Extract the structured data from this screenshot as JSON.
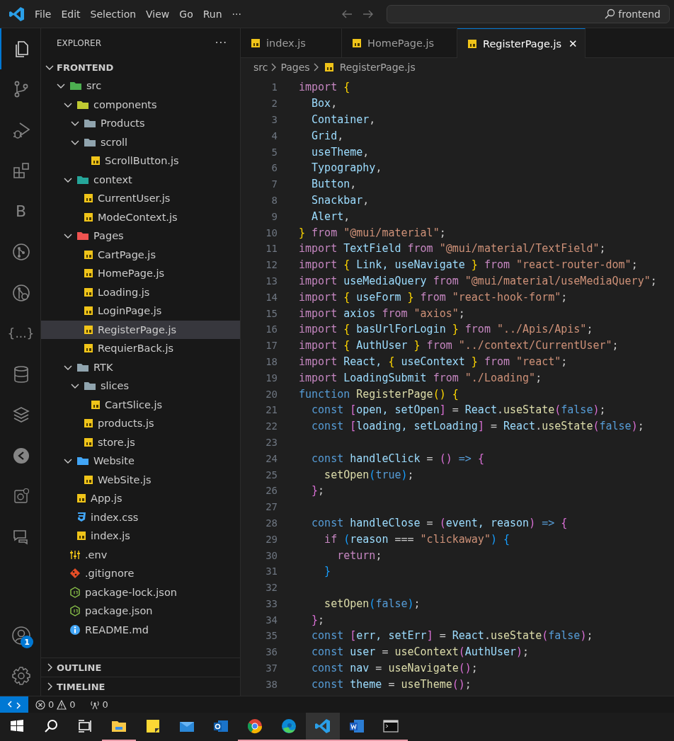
{
  "title_bar": {
    "menu": [
      "File",
      "Edit",
      "Selection",
      "View",
      "Go",
      "Run",
      "···"
    ],
    "command_center": {
      "value": "frontend"
    }
  },
  "activity_bar": {
    "items": [
      {
        "kind": "explorer",
        "selected": true
      },
      {
        "kind": "source-control",
        "selected": false
      },
      {
        "kind": "run-debug",
        "selected": false
      },
      {
        "kind": "extensions",
        "selected": false
      },
      {
        "kind": "letter",
        "text": "B",
        "selected": false
      },
      {
        "kind": "git-graph",
        "selected": false
      },
      {
        "kind": "git-search",
        "selected": false
      },
      {
        "kind": "letter",
        "text": "{...}",
        "selected": false
      },
      {
        "kind": "database",
        "selected": false
      },
      {
        "kind": "layers",
        "selected": false
      },
      {
        "kind": "remote",
        "selected": false
      },
      {
        "kind": "chip",
        "selected": false
      },
      {
        "kind": "chat",
        "selected": false
      }
    ],
    "bottom": [
      {
        "kind": "account",
        "badge": "1"
      },
      {
        "kind": "settings"
      }
    ]
  },
  "sidebar": {
    "title": "EXPLORER",
    "more": "···",
    "root": {
      "label": "FRONTEND",
      "expanded": true,
      "children": [
        {
          "label": "src",
          "kind": "folder",
          "color": "#4caf50",
          "expanded": true,
          "selected": false,
          "children": [
            {
              "label": "components",
              "kind": "folder",
              "color": "#c0ca33",
              "expanded": true,
              "selected": false,
              "children": [
                {
                  "label": "Products",
                  "kind": "folder",
                  "color": "#90a4ae",
                  "expanded": true,
                  "selected": false
                },
                {
                  "label": "scroll",
                  "kind": "folder",
                  "color": "#90a4ae",
                  "expanded": true,
                  "selected": false,
                  "children": [
                    {
                      "label": "ScrollButton.js",
                      "kind": "js",
                      "selected": false
                    }
                  ]
                }
              ]
            },
            {
              "label": "context",
              "kind": "folder",
              "color": "#26a69a",
              "expanded": true,
              "selected": false,
              "children": [
                {
                  "label": "CurrentUser.js",
                  "kind": "js",
                  "selected": false
                },
                {
                  "label": "ModeContext.js",
                  "kind": "js",
                  "selected": false
                }
              ]
            },
            {
              "label": "Pages",
              "kind": "folder",
              "color": "#ef5350",
              "expanded": true,
              "selected": false,
              "children": [
                {
                  "label": "CartPage.js",
                  "kind": "js",
                  "selected": false
                },
                {
                  "label": "HomePage.js",
                  "kind": "js",
                  "selected": false
                },
                {
                  "label": "Loading.js",
                  "kind": "js",
                  "selected": false
                },
                {
                  "label": "LoginPage.js",
                  "kind": "js",
                  "selected": false
                },
                {
                  "label": "RegisterPage.js",
                  "kind": "js",
                  "selected": true
                },
                {
                  "label": "RequierBack.js",
                  "kind": "js",
                  "selected": false
                }
              ]
            },
            {
              "label": "RTK",
              "kind": "folder",
              "color": "#90a4ae",
              "expanded": true,
              "selected": false,
              "children": [
                {
                  "label": "slices",
                  "kind": "folder",
                  "color": "#90a4ae",
                  "expanded": true,
                  "selected": false,
                  "children": [
                    {
                      "label": "CartSlice.js",
                      "kind": "js",
                      "selected": false
                    }
                  ]
                },
                {
                  "label": "products.js",
                  "kind": "js",
                  "selected": false
                },
                {
                  "label": "store.js",
                  "kind": "js",
                  "selected": false
                }
              ]
            },
            {
              "label": "Website",
              "kind": "folder",
              "color": "#42a5f5",
              "expanded": true,
              "selected": false,
              "children": [
                {
                  "label": "WebSite.js",
                  "kind": "js",
                  "selected": false
                }
              ]
            },
            {
              "label": "App.js",
              "kind": "js",
              "selected": false
            },
            {
              "label": "index.css",
              "kind": "css",
              "selected": false
            },
            {
              "label": "index.js",
              "kind": "js",
              "selected": false
            }
          ]
        },
        {
          "label": ".env",
          "kind": "env",
          "selected": false
        },
        {
          "label": ".gitignore",
          "kind": "git",
          "selected": false
        },
        {
          "label": "package-lock.json",
          "kind": "node",
          "selected": false
        },
        {
          "label": "package.json",
          "kind": "node",
          "selected": false
        },
        {
          "label": "README.md",
          "kind": "info",
          "selected": false
        }
      ]
    },
    "sections": [
      {
        "label": "OUTLINE",
        "expanded": false
      },
      {
        "label": "TIMELINE",
        "expanded": false
      }
    ]
  },
  "tabs": [
    {
      "label": "index.js",
      "selected": false
    },
    {
      "label": "HomePage.js",
      "selected": false
    },
    {
      "label": "RegisterPage.js",
      "selected": true,
      "close": "✕"
    }
  ],
  "breadcrumbs": [
    {
      "label": "src"
    },
    {
      "label": "Pages"
    },
    {
      "label": "RegisterPage.js",
      "kind": "js"
    }
  ],
  "code": [
    {
      "number": "1",
      "tokens": [
        {
          "kind": "keyword",
          "text": "import "
        },
        {
          "kind": "bracket1",
          "text": "{"
        }
      ]
    },
    {
      "number": "2",
      "tokens": [
        {
          "kind": "variable",
          "text": "  Box"
        },
        {
          "kind": "plain",
          "text": ","
        }
      ]
    },
    {
      "number": "3",
      "tokens": [
        {
          "kind": "variable",
          "text": "  Container"
        },
        {
          "kind": "plain",
          "text": ","
        }
      ]
    },
    {
      "number": "4",
      "tokens": [
        {
          "kind": "variable",
          "text": "  Grid"
        },
        {
          "kind": "plain",
          "text": ","
        }
      ]
    },
    {
      "number": "5",
      "tokens": [
        {
          "kind": "variable",
          "text": "  useTheme"
        },
        {
          "kind": "plain",
          "text": ","
        }
      ]
    },
    {
      "number": "6",
      "tokens": [
        {
          "kind": "variable",
          "text": "  Typography"
        },
        {
          "kind": "plain",
          "text": ","
        }
      ]
    },
    {
      "number": "7",
      "tokens": [
        {
          "kind": "variable",
          "text": "  Button"
        },
        {
          "kind": "plain",
          "text": ","
        }
      ]
    },
    {
      "number": "8",
      "tokens": [
        {
          "kind": "variable",
          "text": "  Snackbar"
        },
        {
          "kind": "plain",
          "text": ","
        }
      ]
    },
    {
      "number": "9",
      "tokens": [
        {
          "kind": "variable",
          "text": "  Alert"
        },
        {
          "kind": "plain",
          "text": ","
        }
      ]
    },
    {
      "number": "10",
      "tokens": [
        {
          "kind": "bracket1",
          "text": "}"
        },
        {
          "kind": "keyword",
          "text": " from "
        },
        {
          "kind": "string",
          "text": "\"@mui/material\""
        },
        {
          "kind": "plain",
          "text": ";"
        }
      ]
    },
    {
      "number": "11",
      "tokens": [
        {
          "kind": "keyword",
          "text": "import"
        },
        {
          "kind": "variable",
          "text": " TextField "
        },
        {
          "kind": "keyword",
          "text": "from"
        },
        {
          "kind": "string",
          "text": " \"@mui/material/TextField\""
        },
        {
          "kind": "plain",
          "text": ";"
        }
      ]
    },
    {
      "number": "12",
      "tokens": [
        {
          "kind": "keyword",
          "text": "import "
        },
        {
          "kind": "bracket1",
          "text": "{"
        },
        {
          "kind": "variable",
          "text": " Link, useNavigate "
        },
        {
          "kind": "bracket1",
          "text": "}"
        },
        {
          "kind": "keyword",
          "text": " from "
        },
        {
          "kind": "string",
          "text": "\"react-router-dom\""
        },
        {
          "kind": "plain",
          "text": ";"
        }
      ]
    },
    {
      "number": "13",
      "tokens": [
        {
          "kind": "keyword",
          "text": "import"
        },
        {
          "kind": "variable",
          "text": " useMediaQuery "
        },
        {
          "kind": "keyword",
          "text": "from"
        },
        {
          "kind": "string",
          "text": " \"@mui/material/useMediaQuery\""
        },
        {
          "kind": "plain",
          "text": ";"
        }
      ]
    },
    {
      "number": "14",
      "tokens": [
        {
          "kind": "keyword",
          "text": "import "
        },
        {
          "kind": "bracket1",
          "text": "{"
        },
        {
          "kind": "variable",
          "text": " useForm "
        },
        {
          "kind": "bracket1",
          "text": "}"
        },
        {
          "kind": "keyword",
          "text": " from "
        },
        {
          "kind": "string",
          "text": "\"react-hook-form\""
        },
        {
          "kind": "plain",
          "text": ";"
        }
      ]
    },
    {
      "number": "15",
      "tokens": [
        {
          "kind": "keyword",
          "text": "import"
        },
        {
          "kind": "variable",
          "text": " axios "
        },
        {
          "kind": "keyword",
          "text": "from"
        },
        {
          "kind": "string",
          "text": " \"axios\""
        },
        {
          "kind": "plain",
          "text": ";"
        }
      ]
    },
    {
      "number": "16",
      "tokens": [
        {
          "kind": "keyword",
          "text": "import "
        },
        {
          "kind": "bracket1",
          "text": "{"
        },
        {
          "kind": "variable",
          "text": " basUrlForLogin "
        },
        {
          "kind": "bracket1",
          "text": "}"
        },
        {
          "kind": "keyword",
          "text": " from "
        },
        {
          "kind": "string",
          "text": "\"../Apis/Apis\""
        },
        {
          "kind": "plain",
          "text": ";"
        }
      ]
    },
    {
      "number": "17",
      "tokens": [
        {
          "kind": "keyword",
          "text": "import "
        },
        {
          "kind": "bracket1",
          "text": "{"
        },
        {
          "kind": "variable",
          "text": " AuthUser "
        },
        {
          "kind": "bracket1",
          "text": "}"
        },
        {
          "kind": "keyword",
          "text": " from "
        },
        {
          "kind": "string",
          "text": "\"../context/CurrentUser\""
        },
        {
          "kind": "plain",
          "text": ";"
        }
      ]
    },
    {
      "number": "18",
      "tokens": [
        {
          "kind": "keyword",
          "text": "import"
        },
        {
          "kind": "variable",
          "text": " React, "
        },
        {
          "kind": "bracket1",
          "text": "{"
        },
        {
          "kind": "variable",
          "text": " useContext "
        },
        {
          "kind": "bracket1",
          "text": "}"
        },
        {
          "kind": "keyword",
          "text": " from "
        },
        {
          "kind": "string",
          "text": "\"react\""
        },
        {
          "kind": "plain",
          "text": ";"
        }
      ]
    },
    {
      "number": "19",
      "tokens": [
        {
          "kind": "keyword",
          "text": "import"
        },
        {
          "kind": "variable",
          "text": " LoadingSubmit "
        },
        {
          "kind": "keyword",
          "text": "from"
        },
        {
          "kind": "string",
          "text": " \"./Loading\""
        },
        {
          "kind": "plain",
          "text": ";"
        }
      ]
    },
    {
      "number": "20",
      "tokens": [
        {
          "kind": "declaration",
          "text": "function "
        },
        {
          "kind": "function",
          "text": "RegisterPage"
        },
        {
          "kind": "bracket1",
          "text": "() {"
        }
      ]
    },
    {
      "number": "21",
      "tokens": [
        {
          "kind": "declaration",
          "text": "  const "
        },
        {
          "kind": "bracket2",
          "text": "["
        },
        {
          "kind": "variable",
          "text": "open, setOpen"
        },
        {
          "kind": "bracket2",
          "text": "]"
        },
        {
          "kind": "plain",
          "text": " = "
        },
        {
          "kind": "variable",
          "text": "React"
        },
        {
          "kind": "plain",
          "text": "."
        },
        {
          "kind": "function",
          "text": "useState"
        },
        {
          "kind": "bracket2",
          "text": "("
        },
        {
          "kind": "declaration",
          "text": "false"
        },
        {
          "kind": "bracket2",
          "text": ")"
        },
        {
          "kind": "plain",
          "text": ";"
        }
      ]
    },
    {
      "number": "22",
      "tokens": [
        {
          "kind": "declaration",
          "text": "  const "
        },
        {
          "kind": "bracket2",
          "text": "["
        },
        {
          "kind": "variable",
          "text": "loading, setLoading"
        },
        {
          "kind": "bracket2",
          "text": "]"
        },
        {
          "kind": "plain",
          "text": " = "
        },
        {
          "kind": "variable",
          "text": "React"
        },
        {
          "kind": "plain",
          "text": "."
        },
        {
          "kind": "function",
          "text": "useState"
        },
        {
          "kind": "bracket2",
          "text": "("
        },
        {
          "kind": "declaration",
          "text": "false"
        },
        {
          "kind": "bracket2",
          "text": ")"
        },
        {
          "kind": "plain",
          "text": ";"
        }
      ]
    },
    {
      "number": "23"
    },
    {
      "number": "24",
      "tokens": [
        {
          "kind": "declaration",
          "text": "  const "
        },
        {
          "kind": "variable",
          "text": "handleClick"
        },
        {
          "kind": "plain",
          "text": " = "
        },
        {
          "kind": "bracket2",
          "text": "()"
        },
        {
          "kind": "declaration",
          "text": " => "
        },
        {
          "kind": "bracket2",
          "text": "{"
        }
      ]
    },
    {
      "number": "25",
      "tokens": [
        {
          "kind": "function",
          "text": "    setOpen"
        },
        {
          "kind": "bracket3",
          "text": "("
        },
        {
          "kind": "declaration",
          "text": "true"
        },
        {
          "kind": "bracket3",
          "text": ")"
        },
        {
          "kind": "plain",
          "text": ";"
        }
      ]
    },
    {
      "number": "26",
      "tokens": [
        {
          "kind": "bracket2",
          "text": "  }"
        },
        {
          "kind": "plain",
          "text": ";"
        }
      ]
    },
    {
      "number": "27"
    },
    {
      "number": "28",
      "tokens": [
        {
          "kind": "declaration",
          "text": "  const "
        },
        {
          "kind": "variable",
          "text": "handleClose"
        },
        {
          "kind": "plain",
          "text": " = "
        },
        {
          "kind": "bracket2",
          "text": "("
        },
        {
          "kind": "variable",
          "text": "event, reason"
        },
        {
          "kind": "bracket2",
          "text": ")"
        },
        {
          "kind": "declaration",
          "text": " => "
        },
        {
          "kind": "bracket2",
          "text": "{"
        }
      ]
    },
    {
      "number": "29",
      "tokens": [
        {
          "kind": "keyword",
          "text": "    if "
        },
        {
          "kind": "bracket3",
          "text": "("
        },
        {
          "kind": "variable",
          "text": "reason"
        },
        {
          "kind": "plain",
          "text": " === "
        },
        {
          "kind": "string",
          "text": "\"clickaway\""
        },
        {
          "kind": "bracket3",
          "text": ") {"
        }
      ]
    },
    {
      "number": "30",
      "tokens": [
        {
          "kind": "keyword",
          "text": "      return"
        },
        {
          "kind": "plain",
          "text": ";"
        }
      ]
    },
    {
      "number": "31",
      "tokens": [
        {
          "kind": "bracket3",
          "text": "    }"
        }
      ]
    },
    {
      "number": "32"
    },
    {
      "number": "33",
      "tokens": [
        {
          "kind": "function",
          "text": "    setOpen"
        },
        {
          "kind": "bracket3",
          "text": "("
        },
        {
          "kind": "declaration",
          "text": "false"
        },
        {
          "kind": "bracket3",
          "text": ")"
        },
        {
          "kind": "plain",
          "text": ";"
        }
      ]
    },
    {
      "number": "34",
      "tokens": [
        {
          "kind": "bracket2",
          "text": "  }"
        },
        {
          "kind": "plain",
          "text": ";"
        }
      ]
    },
    {
      "number": "35",
      "tokens": [
        {
          "kind": "declaration",
          "text": "  const "
        },
        {
          "kind": "bracket2",
          "text": "["
        },
        {
          "kind": "variable",
          "text": "err, setErr"
        },
        {
          "kind": "bracket2",
          "text": "]"
        },
        {
          "kind": "plain",
          "text": " = "
        },
        {
          "kind": "variable",
          "text": "React"
        },
        {
          "kind": "plain",
          "text": "."
        },
        {
          "kind": "function",
          "text": "useState"
        },
        {
          "kind": "bracket2",
          "text": "("
        },
        {
          "kind": "declaration",
          "text": "false"
        },
        {
          "kind": "bracket2",
          "text": ")"
        },
        {
          "kind": "plain",
          "text": ";"
        }
      ]
    },
    {
      "number": "36",
      "tokens": [
        {
          "kind": "declaration",
          "text": "  const "
        },
        {
          "kind": "variable",
          "text": "user"
        },
        {
          "kind": "plain",
          "text": " = "
        },
        {
          "kind": "function",
          "text": "useContext"
        },
        {
          "kind": "bracket2",
          "text": "("
        },
        {
          "kind": "variable",
          "text": "AuthUser"
        },
        {
          "kind": "bracket2",
          "text": ")"
        },
        {
          "kind": "plain",
          "text": ";"
        }
      ]
    },
    {
      "number": "37",
      "tokens": [
        {
          "kind": "declaration",
          "text": "  const "
        },
        {
          "kind": "variable",
          "text": "nav"
        },
        {
          "kind": "plain",
          "text": " = "
        },
        {
          "kind": "function",
          "text": "useNavigate"
        },
        {
          "kind": "bracket2",
          "text": "()"
        },
        {
          "kind": "plain",
          "text": ";"
        }
      ]
    },
    {
      "number": "38",
      "tokens": [
        {
          "kind": "declaration",
          "text": "  const "
        },
        {
          "kind": "variable",
          "text": "theme"
        },
        {
          "kind": "plain",
          "text": " = "
        },
        {
          "kind": "function",
          "text": "useTheme"
        },
        {
          "kind": "bracket2",
          "text": "()"
        },
        {
          "kind": "plain",
          "text": ";"
        }
      ]
    }
  ],
  "status_bar": {
    "errors": "0",
    "warnings": "0",
    "ports": "0"
  },
  "taskbar": [
    {
      "kind": "start",
      "running": false,
      "selected": false
    },
    {
      "kind": "search",
      "running": false,
      "selected": false
    },
    {
      "kind": "task-view",
      "running": false,
      "selected": false
    },
    {
      "kind": "files",
      "running": true,
      "selected": false
    },
    {
      "kind": "notes",
      "running": false,
      "selected": false
    },
    {
      "kind": "mail",
      "running": false,
      "selected": false
    },
    {
      "kind": "outlook",
      "running": false,
      "selected": false
    },
    {
      "kind": "chrome",
      "running": true,
      "selected": false
    },
    {
      "kind": "edge",
      "running": true,
      "selected": false
    },
    {
      "kind": "code",
      "running": true,
      "selected": true
    },
    {
      "kind": "word",
      "running": true,
      "selected": false
    },
    {
      "kind": "terminal",
      "running": true,
      "selected": false
    }
  ]
}
